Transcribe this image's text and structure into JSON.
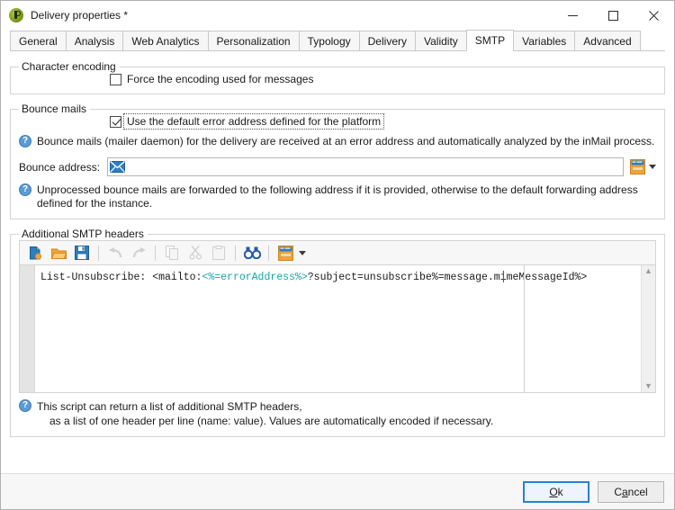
{
  "window": {
    "title": "Delivery properties *",
    "app_icon": "delivery-properties-icon",
    "minimize_label": "─",
    "maximize_label": "□",
    "close_label": "✕"
  },
  "tabs": [
    {
      "label": "General",
      "active": false
    },
    {
      "label": "Analysis",
      "active": false
    },
    {
      "label": "Web Analytics",
      "active": false
    },
    {
      "label": "Personalization",
      "active": false
    },
    {
      "label": "Typology",
      "active": false
    },
    {
      "label": "Delivery",
      "active": false
    },
    {
      "label": "Validity",
      "active": false
    },
    {
      "label": "SMTP",
      "active": true
    },
    {
      "label": "Variables",
      "active": false
    },
    {
      "label": "Advanced",
      "active": false
    }
  ],
  "character_encoding": {
    "legend": "Character encoding",
    "force_encoding_label": "Force the encoding used for messages",
    "force_encoding_checked": false
  },
  "bounce_mails": {
    "legend": "Bounce mails",
    "use_default_error_address_label": "Use the default error address defined for the platform",
    "use_default_error_address_checked": true,
    "hint_1": "Bounce mails (mailer daemon) for the delivery are received at an error address and automatically analyzed by the inMail process.",
    "bounce_address_label": "Bounce address:",
    "bounce_address_value": "",
    "bounce_address_placeholder": "",
    "hint_2": "Unprocessed bounce mails are forwarded to the following address if it is provided, otherwise to the default forwarding address defined for the instance."
  },
  "smtp_headers": {
    "legend": "Additional SMTP headers",
    "toolbar": [
      {
        "name": "new-file-icon",
        "tooltip": "New",
        "disabled": false
      },
      {
        "name": "open-folder-icon",
        "tooltip": "Open",
        "disabled": false
      },
      {
        "name": "save-icon",
        "tooltip": "Save",
        "disabled": false
      },
      {
        "name": "undo-icon",
        "tooltip": "Undo",
        "disabled": true
      },
      {
        "name": "redo-icon",
        "tooltip": "Redo",
        "disabled": true
      },
      {
        "name": "copy-icon",
        "tooltip": "Copy",
        "disabled": true
      },
      {
        "name": "cut-icon",
        "tooltip": "Cut",
        "disabled": true
      },
      {
        "name": "paste-icon",
        "tooltip": "Paste",
        "disabled": true
      },
      {
        "name": "find-icon",
        "tooltip": "Find",
        "disabled": false
      },
      {
        "name": "insert-field-icon",
        "tooltip": "Insert",
        "disabled": false
      }
    ],
    "code_prefix": "List-Unsubscribe: <mailto:",
    "code_variable": "<%=errorAddress%>",
    "code_suffix": "?subject=unsubscribe%=message.mimeMessageId%>",
    "scroll_up": "▲",
    "scroll_down": "▼",
    "hint_line1": "This script can return a list of additional SMTP headers,",
    "hint_line2": "as a list of one header per line (name: value). Values are automatically encoded if necessary."
  },
  "footer": {
    "ok_prefix": "",
    "ok_accel": "O",
    "ok_suffix": "k",
    "cancel_prefix": "C",
    "cancel_accel": "a",
    "cancel_suffix": "ncel"
  },
  "colors": {
    "accent_blue": "#2a7fd4",
    "icon_blue": "#2e7fc1",
    "icon_orange": "#f0a030",
    "token_teal": "#1aa3a3",
    "help_blue": "#5b9bd5"
  }
}
